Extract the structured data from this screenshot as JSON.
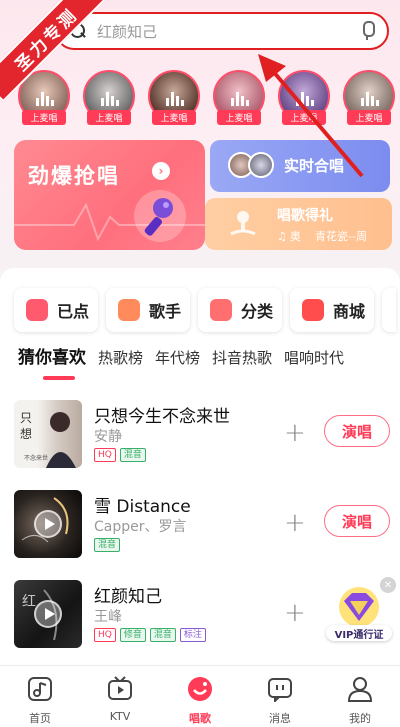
{
  "watermark": "圣力专测",
  "search": {
    "placeholder": "红颜知己"
  },
  "avatars": [
    {
      "badge": "上麦唱"
    },
    {
      "badge": "上麦唱"
    },
    {
      "badge": "上麦唱"
    },
    {
      "badge": "上麦唱"
    },
    {
      "badge": "上麦唱"
    },
    {
      "badge": "上麦唱"
    }
  ],
  "banners": {
    "big": {
      "title": "劲爆抢唱",
      "arrow": "›"
    },
    "chorus": {
      "title": "实时合唱"
    },
    "gift": {
      "title": "唱歌得礼",
      "user": "奥",
      "song": "青花瓷--周"
    }
  },
  "quick_actions": [
    {
      "label": "已点",
      "color": "#ff5a6e",
      "icon": "music-note-icon"
    },
    {
      "label": "歌手",
      "color": "#ff8a5c",
      "icon": "grid-icon"
    },
    {
      "label": "分类",
      "color": "#ff6f6f",
      "icon": "category-icon"
    },
    {
      "label": "商城",
      "color": "#ff4d4d",
      "icon": "shop-icon"
    }
  ],
  "tabs": [
    "猜你喜欢",
    "热歌榜",
    "年代榜",
    "抖音热歌",
    "唱响时代"
  ],
  "songs": [
    {
      "title": "只想今生不念来世",
      "artist": "安静",
      "tags": [
        "HQ",
        "混音"
      ],
      "action": "演唱"
    },
    {
      "title": "雪 Distance",
      "artist": "Capper、罗言",
      "tags": [
        "混音"
      ],
      "action": "演唱"
    },
    {
      "title": "红颜知己",
      "artist": "王峰",
      "tags": [
        "HQ",
        "修音",
        "混音",
        "标注"
      ],
      "action": "演唱"
    }
  ],
  "vip": {
    "label": "VIP通行证",
    "close": "✕"
  },
  "nav": [
    {
      "label": "首页",
      "icon": "music-home-icon"
    },
    {
      "label": "KTV",
      "icon": "tv-icon"
    },
    {
      "label": "唱歌",
      "icon": "sing-icon"
    },
    {
      "label": "消息",
      "icon": "message-icon"
    },
    {
      "label": "我的",
      "icon": "person-icon"
    }
  ],
  "colors": {
    "accent": "#ff3b57",
    "annotation": "#e02020"
  }
}
